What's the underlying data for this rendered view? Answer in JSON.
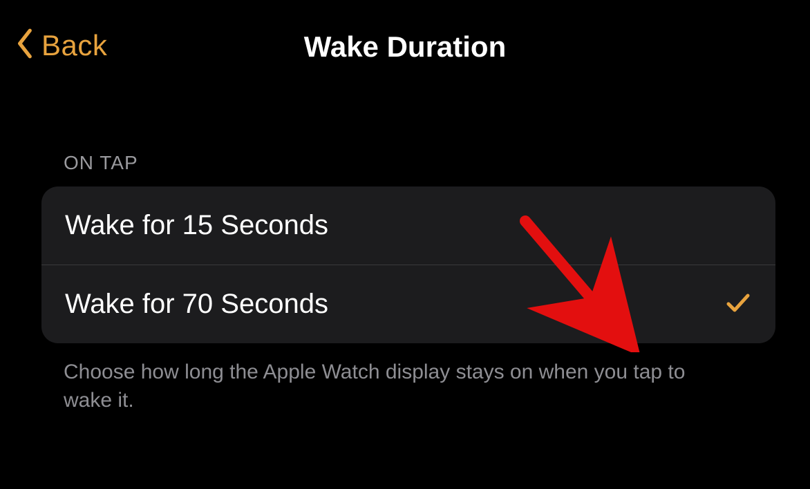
{
  "colors": {
    "accent": "#e8a33e",
    "annotation": "#e30f0f"
  },
  "header": {
    "back_label": "Back",
    "title": "Wake Duration"
  },
  "section": {
    "header": "ON TAP",
    "options": [
      {
        "label": "Wake for 15 Seconds",
        "selected": false
      },
      {
        "label": "Wake for 70 Seconds",
        "selected": true
      }
    ],
    "footer": "Choose how long the Apple Watch display stays on when you tap to wake it."
  },
  "annotation": {
    "type": "arrow",
    "points_to_option_index": 1
  }
}
